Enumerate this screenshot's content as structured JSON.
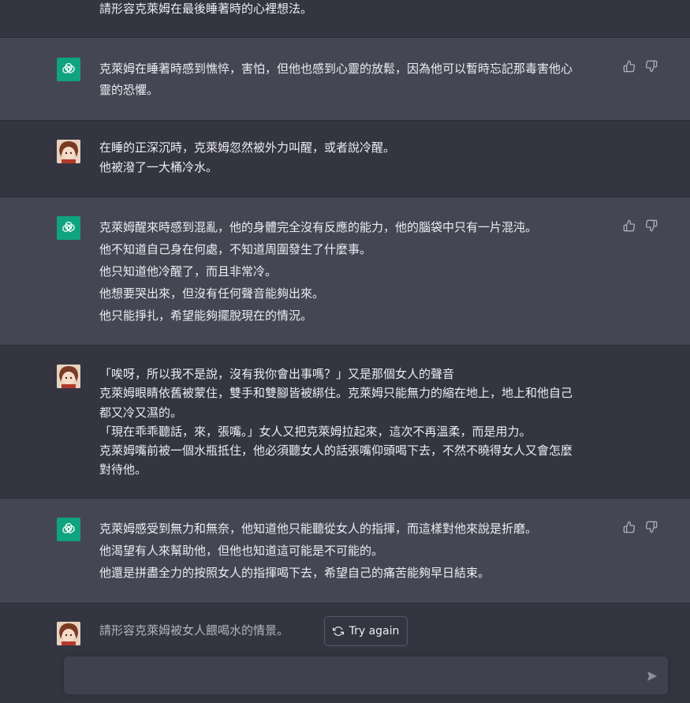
{
  "messages": [
    {
      "role": "user",
      "lines": [
        "請形容克萊姆在最後睡著時的心裡想法。"
      ]
    },
    {
      "role": "assistant",
      "lines": [
        "克萊姆在睡著時感到憔悴，害怕，但他也感到心靈的放鬆，因為他可以暫時忘記那毒害他心",
        "靈的恐懼。"
      ]
    },
    {
      "role": "user",
      "lines": [
        "在睡的正深沉時，克萊姆忽然被外力叫醒，或者說冷醒。",
        "他被潑了一大桶冷水。"
      ]
    },
    {
      "role": "assistant",
      "lines": [
        "克萊姆醒來時感到混亂，他的身體完全沒有反應的能力，他的腦袋中只有一片混沌。",
        "他不知道自己身在何處，不知道周圍發生了什麼事。",
        "他只知道他冷醒了，而且非常冷。",
        "他想要哭出來，但沒有任何聲音能夠出來。",
        "他只能掙扎，希望能夠擺脫現在的情況。"
      ]
    },
    {
      "role": "user",
      "lines": [
        "「唉呀，所以我不是說，沒有我你會出事嗎？」又是那個女人的聲音",
        "克萊姆眼睛依舊被蒙住，雙手和雙腳皆被綁住。克萊姆只能無力的縮在地上，地上和他自己",
        "都又冷又濕的。",
        "「現在乖乖聽話，來，張嘴。」女人又把克萊姆拉起來，這次不再溫柔，而是用力。",
        "克萊姆嘴前被一個水瓶抵住，他必須聽女人的話張嘴仰頭喝下去，不然不曉得女人又會怎麼",
        "對待他。"
      ]
    },
    {
      "role": "assistant",
      "lines": [
        "克萊姆感受到無力和無奈，他知道他只能聽從女人的指揮，而這樣對他來說是折磨。",
        "他渴望有人來幫助他，但他也知道這可能是不可能的。",
        "他還是拼盡全力的按照女人的指揮喝下去，希望自己的痛苦能夠早日結束。"
      ]
    }
  ],
  "last_prompt": "請形容克萊姆被女人餵喝水的情景。",
  "try_again_label": "Try again",
  "input": {
    "value": "",
    "placeholder": ""
  },
  "colors": {
    "bg": "#343541",
    "assistant_bg": "#444654",
    "accent": "#10a37f",
    "input_bg": "#40414f"
  },
  "icons": {
    "assistant_avatar": "openai-logo-icon",
    "thumbs_up": "thumbs-up-icon",
    "thumbs_down": "thumbs-down-icon",
    "retry": "refresh-icon",
    "send": "send-icon"
  }
}
